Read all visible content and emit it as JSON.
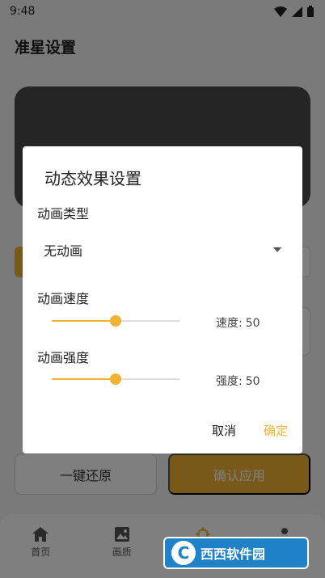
{
  "status_bar": {
    "time": "9:48"
  },
  "page": {
    "title": "准星设置"
  },
  "actions": {
    "reset_label": "一键还原",
    "apply_label": "确认应用"
  },
  "bottom_nav": {
    "items": [
      {
        "label": "首页",
        "icon": "home-icon"
      },
      {
        "label": "画质",
        "icon": "image-icon"
      },
      {
        "label": "",
        "icon": "crosshair-icon"
      },
      {
        "label": "",
        "icon": "person-icon"
      }
    ]
  },
  "dialog": {
    "title": "动态效果设置",
    "animation_type": {
      "label": "动画类型",
      "value": "无动画"
    },
    "speed": {
      "label": "动画速度",
      "value_prefix": "速度:",
      "value": 50,
      "max": 100
    },
    "intensity": {
      "label": "动画强度",
      "value_prefix": "强度:",
      "value": 50,
      "max": 100
    },
    "cancel_label": "取消",
    "ok_label": "确定"
  },
  "theme": {
    "accent": "#f2b233"
  },
  "watermark": {
    "text": "西西软件园",
    "logo_letter": "C"
  }
}
